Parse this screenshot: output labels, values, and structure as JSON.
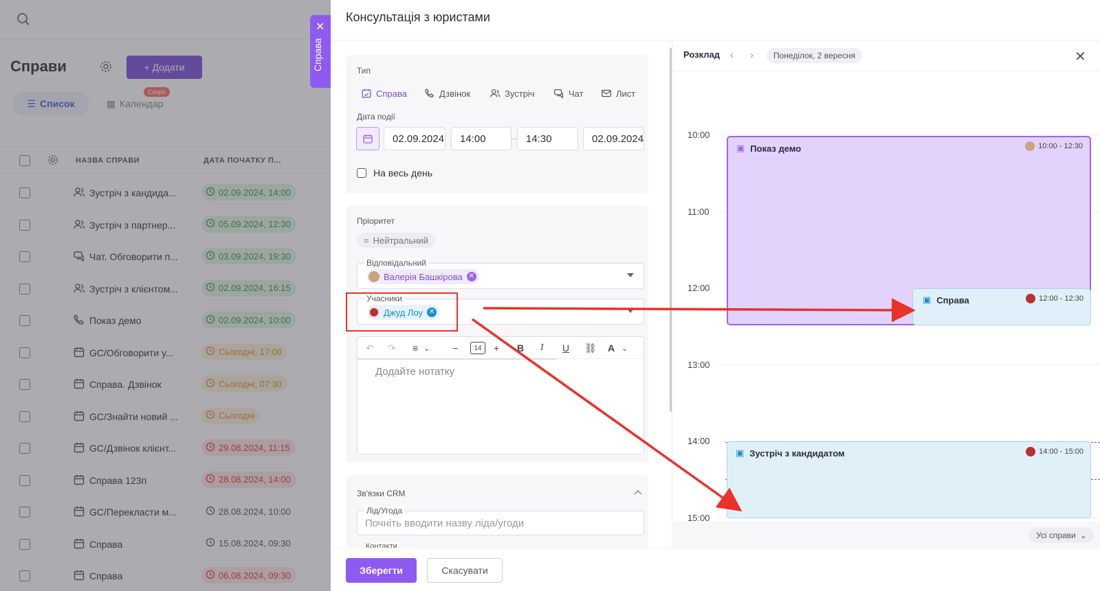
{
  "background": {
    "title": "Справи",
    "add_button": "+ Додати",
    "tabs": {
      "list": "Список",
      "calendar": "Календар",
      "soon_badge": "Скоро"
    },
    "table": {
      "headers": [
        "НАЗВА СПРАВИ",
        "ДАТА ПОЧАТКУ П..."
      ],
      "rows": [
        {
          "icon": "people-icon",
          "name": "Зустріч з кандида...",
          "date": "02.09.2024, 14:00",
          "status": "green"
        },
        {
          "icon": "people-icon",
          "name": "Зустріч з партнер...",
          "date": "05.09.2024, 12:30",
          "status": "green"
        },
        {
          "icon": "chat-icon",
          "name": "Чат. Обговорити п...",
          "date": "03.09.2024, 19:30",
          "status": "green"
        },
        {
          "icon": "people-icon",
          "name": "Зустріч з клієнтом...",
          "date": "02.09.2024, 16:15",
          "status": "green"
        },
        {
          "icon": "phone-icon",
          "name": "Показ демо",
          "date": "02.09.2024, 10:00",
          "status": "green"
        },
        {
          "icon": "calendar-icon",
          "name": "GC/Обговорити у...",
          "date": "Сьогодні, 17:00",
          "status": "orange"
        },
        {
          "icon": "calendar-icon",
          "name": "Справа. Дзвінок",
          "date": "Сьогодні, 07:30",
          "status": "orange"
        },
        {
          "icon": "calendar-icon",
          "name": "GC/Знайти новий ...",
          "date": "Сьогодні",
          "status": "orange"
        },
        {
          "icon": "calendar-icon",
          "name": "GC/Дзвінок клієнт...",
          "date": "29.08.2024, 11:15",
          "status": "red"
        },
        {
          "icon": "calendar-icon",
          "name": "Справа 123п",
          "date": "28.08.2024, 14:00",
          "status": "red"
        },
        {
          "icon": "calendar-icon",
          "name": "GC/Перекласти м...",
          "date": "28.08.2024, 10:00",
          "status": "plain"
        },
        {
          "icon": "calendar-icon",
          "name": "Справа",
          "date": "15.08.2024, 09:30",
          "status": "plain"
        },
        {
          "icon": "calendar-icon",
          "name": "Справа",
          "date": "06.08.2024, 09:30",
          "status": "red"
        }
      ]
    }
  },
  "side_tab": {
    "label": "Справа",
    "close": "✕"
  },
  "drawer": {
    "title": "Консультація з юристами",
    "type_label": "Тип",
    "types": [
      {
        "label": "Справа",
        "icon": "calendar-check-icon",
        "active": true
      },
      {
        "label": "Дзвінок",
        "icon": "phone-icon",
        "active": false
      },
      {
        "label": "Зустріч",
        "icon": "people-icon",
        "active": false
      },
      {
        "label": "Чат",
        "icon": "chat-icon",
        "active": false
      },
      {
        "label": "Лист",
        "icon": "mail-icon",
        "active": false
      }
    ],
    "date_label": "Дата події",
    "date_start": "02.09.2024",
    "time_start": "14:00",
    "time_end": "14:30",
    "date_end": "02.09.2024",
    "all_day": "На весь день",
    "priority_label": "Пріоритет",
    "priority_value": "Нейтральний",
    "responsible_label": "Відповідальний",
    "responsible": "Валерія Башкірова",
    "participants_label": "Учасники",
    "participant": "Джуд Лоу",
    "font_size": "14",
    "note_placeholder": "Додайте нотатку",
    "crm_label": "Зв'язки CRM",
    "lead_label": "Лід/Угода",
    "lead_placeholder": "Почніть вводити назву ліда/угоди",
    "contacts_label": "Контакти",
    "save": "Зберегти",
    "cancel": "Скасувати"
  },
  "schedule": {
    "title": "Розклад",
    "date": "Понеділок, 2 вересня",
    "hours": [
      "10:00",
      "11:00",
      "12:00",
      "13:00",
      "14:00",
      "15:00"
    ],
    "events": [
      {
        "title": "Показ демо",
        "time": "10:00 - 12:30",
        "color": "#e3d2fb"
      },
      {
        "title": "Справа",
        "time": "12:00 - 12:30",
        "color": "#e0f0f9"
      },
      {
        "title": "Зустріч з кандидатом",
        "time": "14:00 - 15:00",
        "color": "#e0f0f9"
      }
    ],
    "filter": "Усі справи"
  },
  "colors": {
    "accent": "#8e5bf0",
    "annotation": "#e8322a"
  }
}
